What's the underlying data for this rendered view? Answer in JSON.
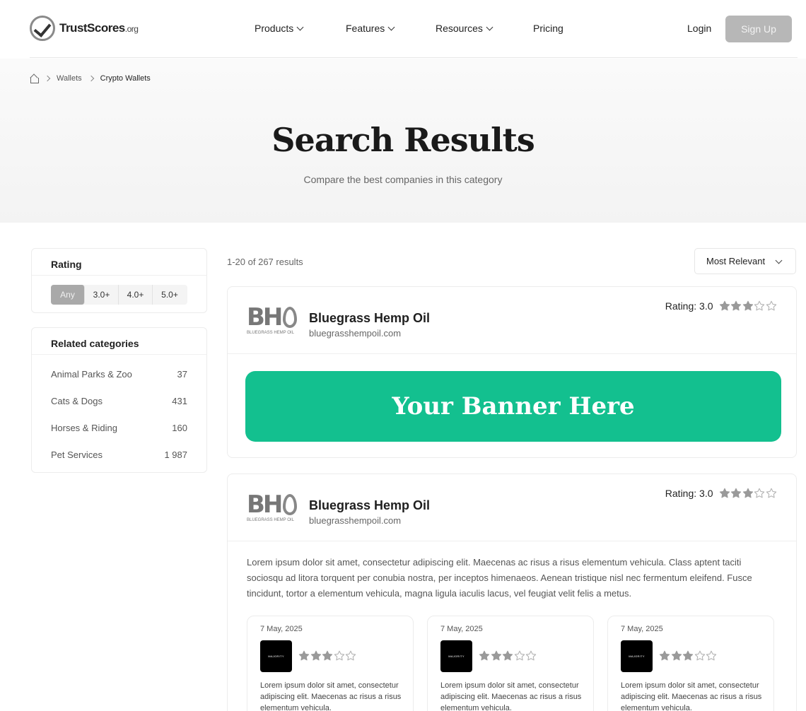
{
  "header": {
    "logo_text": "TrustScores",
    "logo_suffix": ".org",
    "nav": [
      "Products",
      "Features",
      "Resources",
      "Pricing"
    ],
    "login": "Login",
    "signup": "Sign Up"
  },
  "breadcrumb": {
    "items": [
      "Wallets",
      "Crypto Wallets"
    ]
  },
  "hero": {
    "title": "Search Results",
    "subtitle": "Compare the best companies in this category"
  },
  "filters": {
    "rating_title": "Rating",
    "rating_options": [
      "Any",
      "3.0+",
      "4.0+",
      "5.0+"
    ],
    "selected_rating": "Any",
    "categories_title": "Related categories",
    "categories": [
      {
        "name": "Animal Parks & Zoo",
        "count": "37"
      },
      {
        "name": "Cats & Dogs",
        "count": "431"
      },
      {
        "name": "Horses & Riding",
        "count": "160"
      },
      {
        "name": "Pet Services",
        "count": "1 987"
      }
    ]
  },
  "results": {
    "count_text": "1-20 of 267 results",
    "sort_label": "Most Relevant",
    "items": [
      {
        "logo_letters": "BH",
        "logo_tagline": "BLUEGRASS HEMP OIL",
        "name": "Bluegrass Hemp Oil",
        "url": "bluegrasshempoil.com",
        "rating_text": "Rating: 3.0",
        "rating": 3,
        "banner": "Your Banner Here"
      },
      {
        "logo_letters": "BH",
        "logo_tagline": "BLUEGRASS HEMP OIL",
        "name": "Bluegrass Hemp Oil",
        "url": "bluegrasshempoil.com",
        "rating_text": "Rating: 3.0",
        "rating": 3,
        "description": "Lorem ipsum dolor sit amet, consectetur adipiscing elit. Maecenas ac risus a risus elementum vehicula. Class aptent taciti sociosqu ad litora torquent per conubia nostra, per inceptos himenaeos. Aenean tristique nisl nec fermentum eleifend. Fusce tincidunt, tortor a elementum vehicula, magna ligula iaculis lacus, vel feugiat velit felis a metus.",
        "reviews": [
          {
            "date": "7 May, 2025",
            "avatar_text": "MAJORITY",
            "rating": 3,
            "text": "Lorem ipsum dolor sit amet, consectetur adipiscing elit. Maecenas ac risus a risus elementum vehicula."
          },
          {
            "date": "7 May, 2025",
            "avatar_text": "MAJORITY",
            "rating": 3,
            "text": "Lorem ipsum dolor sit amet, consectetur adipiscing elit. Maecenas ac risus a risus elementum vehicula."
          },
          {
            "date": "7 May, 2025",
            "avatar_text": "MAJORITY",
            "rating": 3,
            "text": "Lorem ipsum dolor sit amet, consectetur adipiscing elit. Maecenas ac risus a risus elementum vehicula."
          }
        ]
      }
    ]
  },
  "colors": {
    "accent": "#13c08f",
    "star_filled": "#9a9a9a",
    "star_empty": "#b5b5b5"
  }
}
